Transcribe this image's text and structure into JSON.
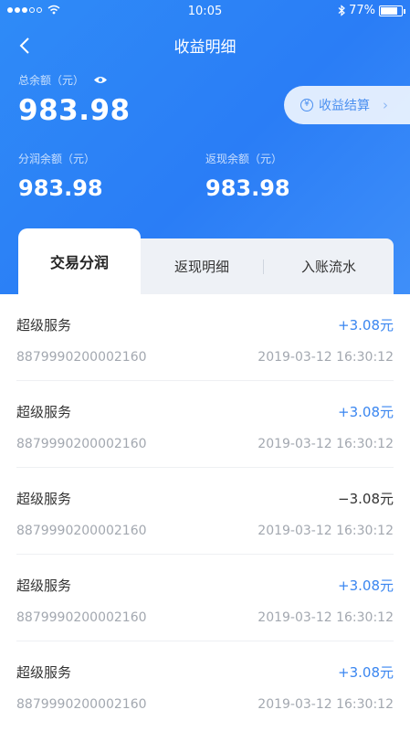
{
  "status": {
    "time": "10:05",
    "battery": "77%"
  },
  "nav": {
    "title": "收益明细"
  },
  "summary": {
    "total_label": "总余额（元）",
    "total_amount": "983.98",
    "settle_label": "收益结算",
    "share_label": "分润余额（元）",
    "share_amount": "983.98",
    "cashback_label": "返现余额（元）",
    "cashback_amount": "983.98"
  },
  "tabs": [
    {
      "label": "交易分润"
    },
    {
      "label": "返现明细"
    },
    {
      "label": "入账流水"
    }
  ],
  "records": [
    {
      "title": "超级服务",
      "amount": "+3.08元",
      "id": "8879990200002160",
      "time": "2019-03-12 16:30:12"
    },
    {
      "title": "超级服务",
      "amount": "+3.08元",
      "id": "8879990200002160",
      "time": "2019-03-12 16:30:12"
    },
    {
      "title": "超级服务",
      "amount": "−3.08元",
      "id": "8879990200002160",
      "time": "2019-03-12 16:30:12"
    },
    {
      "title": "超级服务",
      "amount": "+3.08元",
      "id": "8879990200002160",
      "time": "2019-03-12 16:30:12"
    },
    {
      "title": "超级服务",
      "amount": "+3.08元",
      "id": "8879990200002160",
      "time": "2019-03-12 16:30:12"
    }
  ],
  "colors": {
    "accent": "#2f8bf7",
    "positive": "#3a86f0",
    "muted": "#a3a8b0"
  },
  "icons": {
    "back": "chevron-left-icon",
    "eye": "eye-icon",
    "settle": "yen-circle-icon",
    "arrow": "chevron-right-icon"
  }
}
